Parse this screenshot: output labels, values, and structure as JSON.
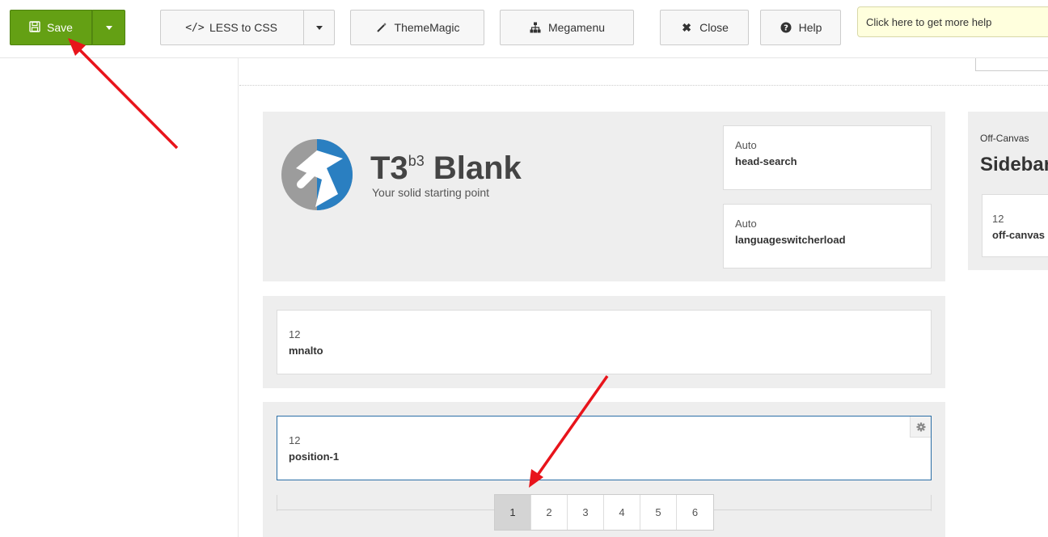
{
  "toolbar": {
    "save_label": "Save",
    "less_label": "LESS to CSS",
    "thememagic_label": "ThemeMagic",
    "megamenu_label": "Megamenu",
    "close_label": "Close",
    "help_label": "Help",
    "tooltip_text": "Click here to get more help"
  },
  "header_row": {
    "logo_title": "T3",
    "logo_sup": "b3",
    "logo_title2": "Blank",
    "logo_tagline": "Your solid starting point",
    "positions": [
      {
        "size": "Auto",
        "name": "head-search"
      },
      {
        "size": "Auto",
        "name": "languageswitcherload"
      }
    ]
  },
  "offcanvas": {
    "label": "Off-Canvas",
    "title": "Sidebar",
    "size": "12",
    "name": "off-canvas"
  },
  "mainnav_row": {
    "size": "12",
    "name": "mnalto"
  },
  "spotlight_row": {
    "size": "12",
    "name": "position-1"
  },
  "pager": {
    "pages": [
      "1",
      "2",
      "3",
      "4",
      "5",
      "6"
    ],
    "active": "1"
  },
  "colors": {
    "save_green": "#64a014",
    "annotation_arrow": "#e8141b",
    "row_bg": "#eeeeee",
    "selected_border": "#2a6ea6"
  }
}
